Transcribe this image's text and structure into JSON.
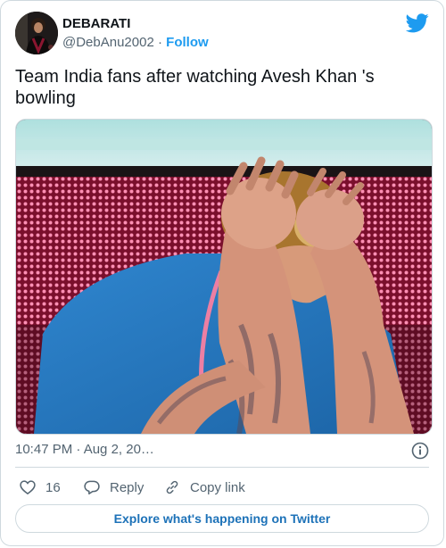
{
  "user": {
    "display_name": "DEBARATI",
    "handle": "@DebAnu2002",
    "separator": "·",
    "follow_label": "Follow"
  },
  "tweet": {
    "text": "Team India fans after watching Avesh Khan 's bowling",
    "time": "10:47 PM · Aug 2, 20…"
  },
  "actions": {
    "like_count": "16",
    "reply_label": "Reply",
    "copy_link_label": "Copy link"
  },
  "footer": {
    "explore_label": "Explore what's happening on Twitter"
  },
  "colors": {
    "accent": "#1d9bf0",
    "muted": "#536471",
    "border": "#cfd9de"
  },
  "icons": [
    "twitter-bird-icon",
    "info-icon",
    "heart-icon",
    "reply-icon",
    "link-icon"
  ]
}
